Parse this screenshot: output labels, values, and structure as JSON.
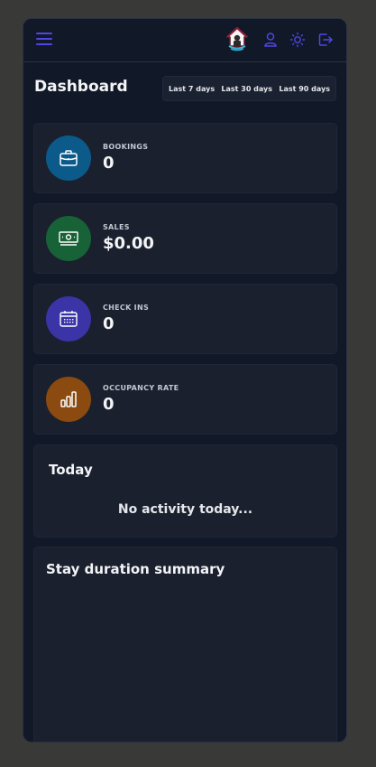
{
  "header": {
    "menu_icon": "hamburger-menu-icon",
    "logo_icon": "house-logo-icon",
    "user_icon": "user-icon",
    "theme_icon": "sun-icon",
    "logout_icon": "logout-icon"
  },
  "page": {
    "title": "Dashboard"
  },
  "date_range": {
    "options": [
      "Last 7 days",
      "Last 30 days",
      "Last 90 days"
    ]
  },
  "stats": [
    {
      "label": "BOOKINGS",
      "value": "0",
      "icon": "briefcase-icon",
      "color": "#0c5a8a"
    },
    {
      "label": "SALES",
      "value": "$0.00",
      "icon": "banknote-icon",
      "color": "#176236"
    },
    {
      "label": "CHECK INS",
      "value": "0",
      "icon": "calendar-icon",
      "color": "#3a34a6"
    },
    {
      "label": "OCCUPANCY RATE",
      "value": "0",
      "icon": "bar-chart-icon",
      "color": "#8a4a10"
    }
  ],
  "today": {
    "title": "Today",
    "empty_message": "No activity today..."
  },
  "stay_duration": {
    "title": "Stay duration summary"
  },
  "colors": {
    "accent": "#4f46e5",
    "background": "#111827",
    "card": "#1a202e"
  }
}
